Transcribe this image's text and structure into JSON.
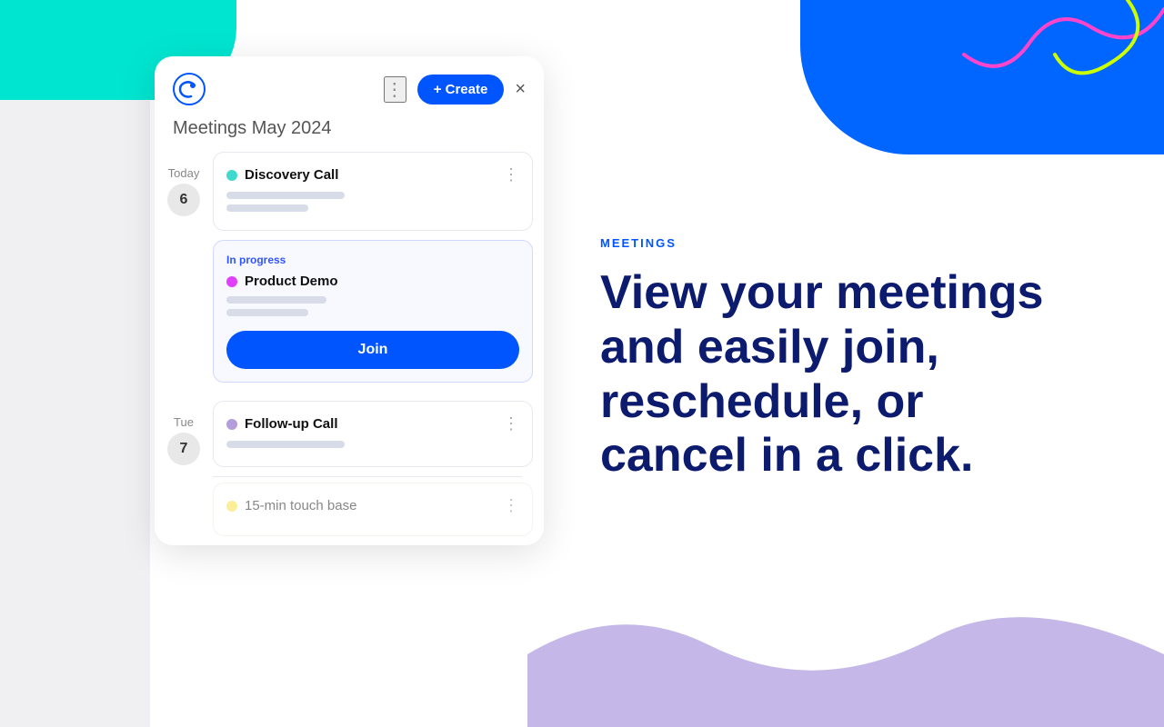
{
  "app": {
    "logo_text": "C",
    "header": {
      "three_dots": "⋮",
      "create_label": "+ Create",
      "close_label": "×"
    },
    "meetings_title": "Meetings",
    "meetings_month": "May 2024"
  },
  "today": {
    "day_label": "Today",
    "day_number": "6"
  },
  "tuesday": {
    "day_label": "Tue",
    "day_number": "7"
  },
  "events": [
    {
      "id": "discovery-call",
      "name": "Discovery Call",
      "dot_color": "teal",
      "in_progress": false,
      "has_join": false
    },
    {
      "id": "product-demo",
      "name": "Product Demo",
      "dot_color": "pink",
      "in_progress": true,
      "in_progress_label": "In progress",
      "has_join": true,
      "join_label": "Join"
    },
    {
      "id": "follow-up-call",
      "name": "Follow-up Call",
      "dot_color": "purple",
      "in_progress": false,
      "has_join": false
    },
    {
      "id": "15-min-touch-base",
      "name": "15-min touch base",
      "dot_color": "yellow",
      "in_progress": false,
      "has_join": false
    }
  ],
  "right_content": {
    "label": "MEETINGS",
    "heading": "View your meetings and easily join, reschedule, or cancel in a click."
  },
  "colors": {
    "primary": "#0055ff",
    "teal": "#40d9d0",
    "pink": "#e040fb",
    "purple": "#b39ddb",
    "yellow": "#f9e76a",
    "in_progress_text": "#3355ff"
  }
}
